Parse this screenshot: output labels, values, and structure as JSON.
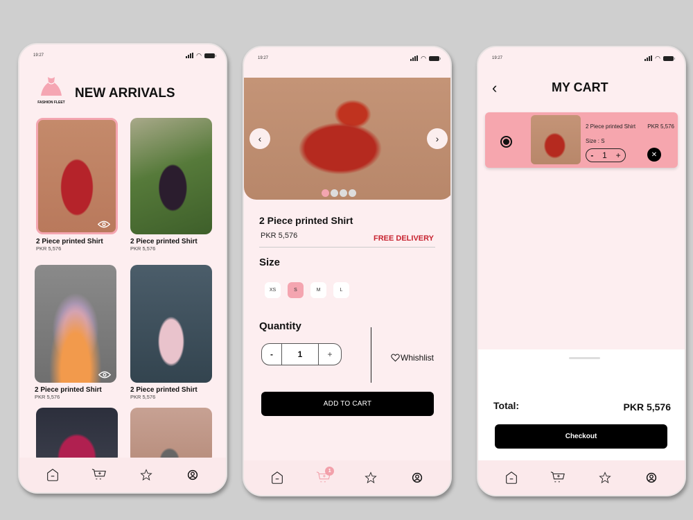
{
  "status_bar": {
    "time": "19:27"
  },
  "colors": {
    "accent_pink": "#f4a5b0",
    "free_delivery_red": "#c7222f",
    "background": "#fdeef0"
  },
  "screen1": {
    "brand": "FASHION FLEET",
    "title": "NEW ARRIVALS",
    "products": [
      {
        "name": "2 Piece printed Shirt",
        "price": "PKR 5,576",
        "image": "woman-in-red-printed-dress"
      },
      {
        "name": "2 Piece printed Shirt",
        "price": "PKR 5,576",
        "image": "woman-in-floral-dress-greenhouse"
      },
      {
        "name": "2 Piece printed Shirt",
        "price": "PKR 5,576",
        "image": "pastel-gradient-gown-mannequin"
      },
      {
        "name": "2 Piece printed Shirt",
        "price": "PKR 5,576",
        "image": "woman-in-pink-gown"
      },
      {
        "name": "",
        "price": "",
        "image": "woman-in-magenta-gown"
      },
      {
        "name": "",
        "price": "",
        "image": "woman-in-sequin-dress"
      }
    ]
  },
  "screen2": {
    "product_name": "2 Piece printed Shirt",
    "price": "PKR 5,576",
    "delivery": "FREE DELIVERY",
    "size_label": "Size",
    "sizes": [
      "XS",
      "S",
      "M",
      "L"
    ],
    "selected_size": "S",
    "quantity_label": "Quantity",
    "quantity": "1",
    "minus": "-",
    "plus": "+",
    "wishlist": "Whishlist",
    "add_to_cart": "ADD TO CART",
    "carousel_count": 4,
    "carousel_active": 0,
    "cart_badge": "1"
  },
  "screen3": {
    "title": "MY CART",
    "item": {
      "name": "2 Piece printed Shirt",
      "price": "PKR 5,576",
      "size": "Size : S",
      "quantity": "1",
      "minus": "-",
      "plus": "+"
    },
    "total_label": "Total:",
    "total_value": "PKR 5,576",
    "checkout": "Checkout"
  },
  "nav": [
    "home",
    "cart",
    "favorites",
    "profile"
  ]
}
